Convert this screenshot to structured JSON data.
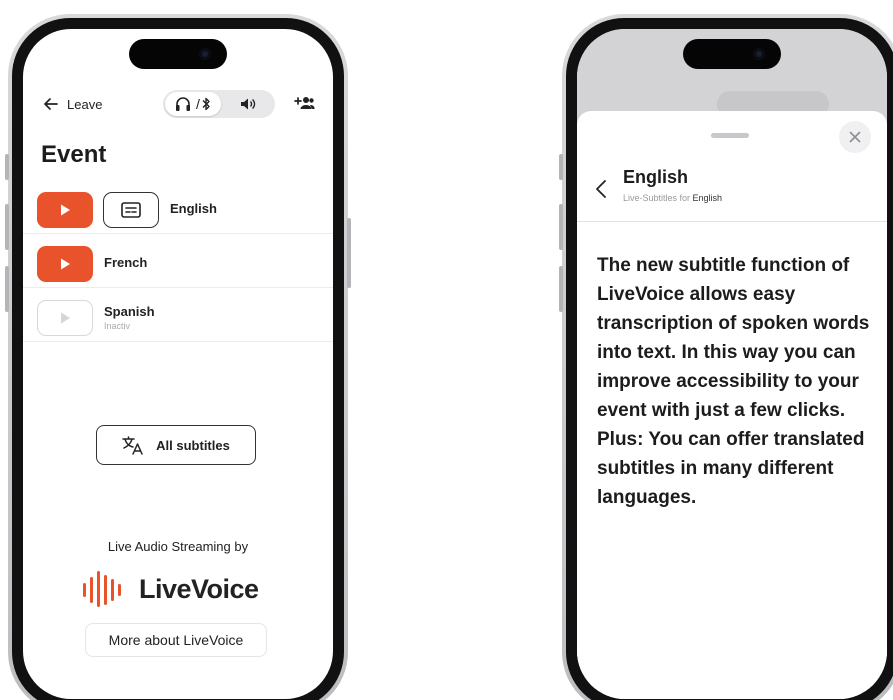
{
  "colors": {
    "accent": "#e8532b",
    "text": "#1c1c1e",
    "muted": "#aaaaaa"
  },
  "phone1": {
    "topbar": {
      "leave_label": "Leave",
      "audio_toggle": {
        "active_icon": "headphones-bluetooth-icon",
        "active_text": "/",
        "other_icon": "speaker-icon"
      },
      "add_user_icon": "add-user-icon"
    },
    "page_title": "Event",
    "languages": [
      {
        "name": "English",
        "status": "",
        "playing": true,
        "subtitles": true
      },
      {
        "name": "French",
        "status": "",
        "playing": true,
        "subtitles": false
      },
      {
        "name": "Spanish",
        "status": "Inactiv",
        "playing": false,
        "subtitles": false
      }
    ],
    "all_subtitles_label": "All subtitles",
    "powered_by": "Live Audio Streaming by",
    "brand_name": "LiveVoice",
    "more_label": "More about LiveVoice"
  },
  "phone2": {
    "sheet_title": "English",
    "sheet_subtitle_prefix": "Live-Subtitles for",
    "sheet_subtitle_lang": "English",
    "body_text": "The new subtitle function of LiveVoice allows easy transcription of spoken words into text. In this way you can improve accessibility to your event with just a few clicks. Plus: You can offer translated subtitles in many different languages."
  }
}
